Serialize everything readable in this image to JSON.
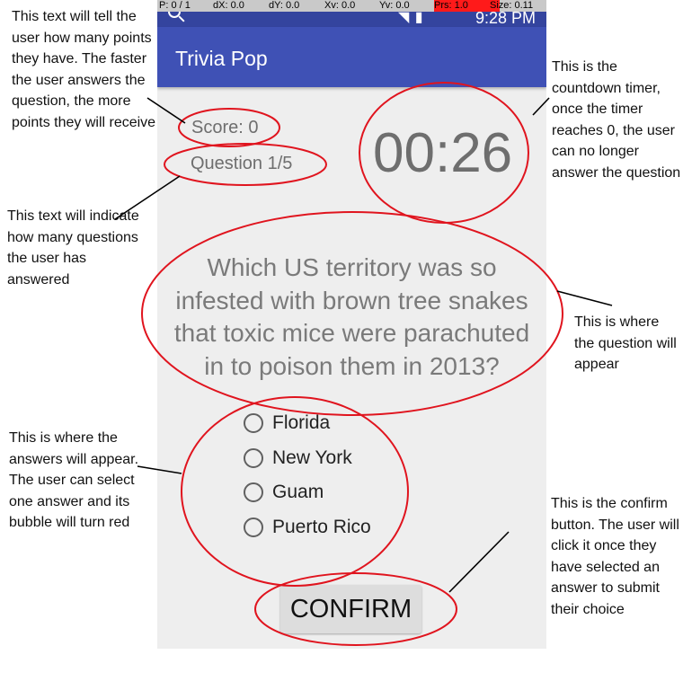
{
  "debug_bar": {
    "pointer": "P: 0 / 1",
    "dx": "dX: 0.0",
    "dy": "dY: 0.0",
    "xv": "Xv: 0.0",
    "yv": "Yv: 0.0",
    "prs": "Prs: 1.0",
    "size": "Size: 0.11"
  },
  "status_bar": {
    "time": "9:28 PM"
  },
  "app_bar": {
    "title": "Trivia Pop"
  },
  "game": {
    "score": "Score: 0",
    "question_count": "Question 1/5",
    "timer": "00:26",
    "question": "Which US territory was so infested with brown tree snakes that toxic mice were parachuted in to poison them in 2013?",
    "answers": [
      "Florida",
      "New York",
      "Guam",
      "Puerto Rico"
    ],
    "selected_answer": null,
    "confirm_label": "CONFIRM"
  },
  "annotations": {
    "score_note": "This text will tell the user how many points they have. The faster the user answers the question, the more points they will receive",
    "question_count_note": "This text will indicate how many questions the user has answered",
    "answers_note": "This is where the answers will appear. The user can select one answer and its bubble will turn red",
    "timer_note": "This is the countdown timer, once the timer reaches 0, the user can no longer answer the question",
    "question_note": "This is where the question will appear",
    "confirm_note": "This is the confirm button. The user will click it once they have selected an answer to submit their choice"
  },
  "colors": {
    "app_bar": "#3f51b5",
    "status_bar": "#34449e",
    "background": "#eeeeee",
    "annotation_ellipse": "#e0141e"
  }
}
